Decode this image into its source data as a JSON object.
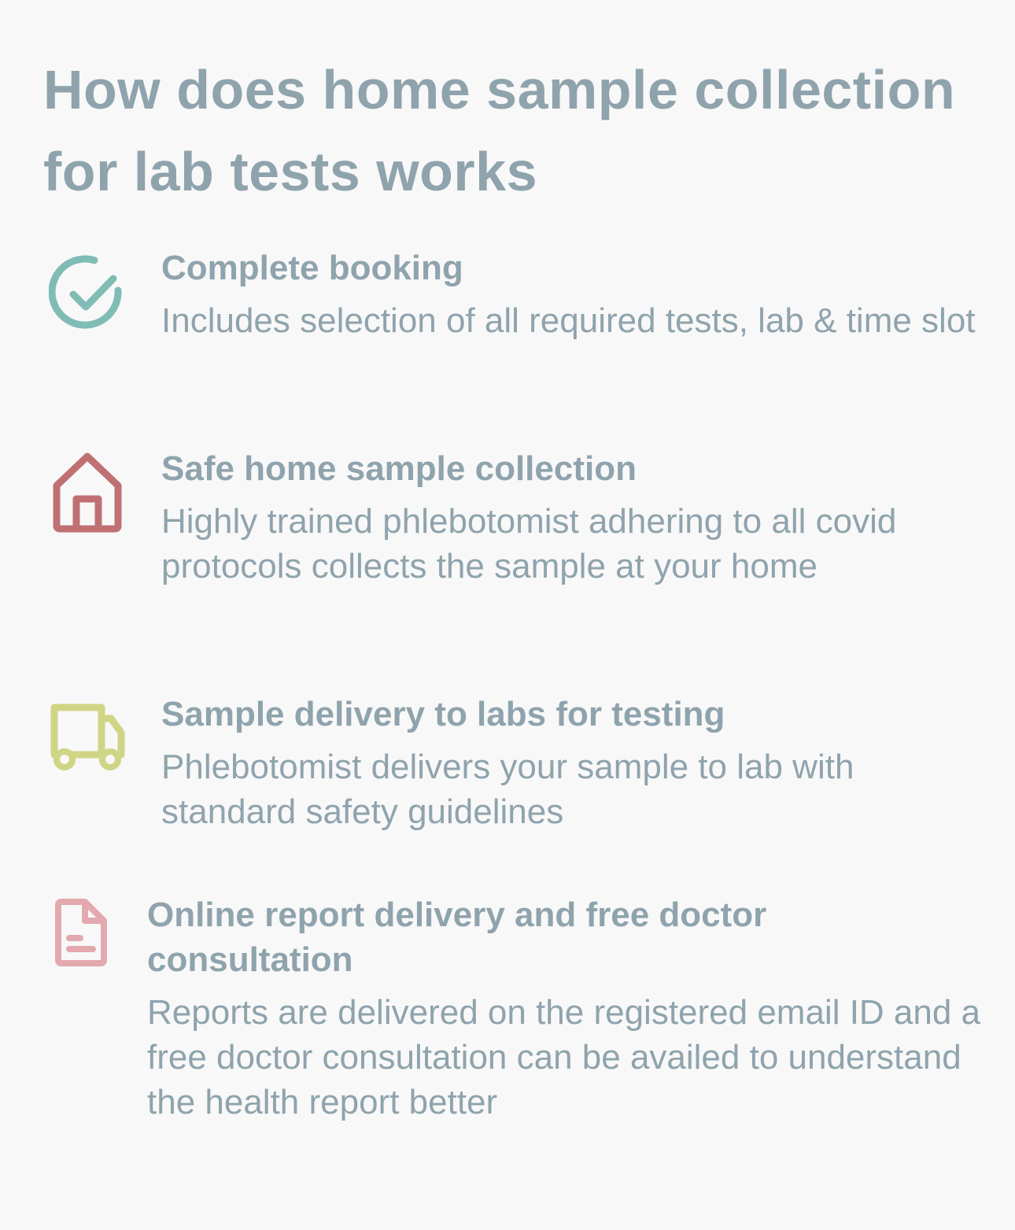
{
  "header": {
    "title": "How does home sample collection for lab tests works"
  },
  "steps": [
    {
      "icon": "check-circle-icon",
      "color": "#7fbcb5",
      "title": "Complete booking",
      "description": "Includes selection of all required tests, lab & time slot"
    },
    {
      "icon": "home-icon",
      "color": "#c07073",
      "title": "Safe home sample collection",
      "description": "Highly trained phlebotomist adhering to all covid protocols collects the sample at your home"
    },
    {
      "icon": "truck-icon",
      "color": "#cfd584",
      "title": "Sample delivery to labs for testing",
      "description": "Phlebotomist delivers your sample to lab with standard safety guidelines"
    },
    {
      "icon": "document-icon",
      "color": "#e3a9ae",
      "title": "Online report delivery  and free doctor consultation",
      "description": "Reports are delivered on the registered email ID and a free doctor consultation can be availed to understand the health report better"
    }
  ]
}
